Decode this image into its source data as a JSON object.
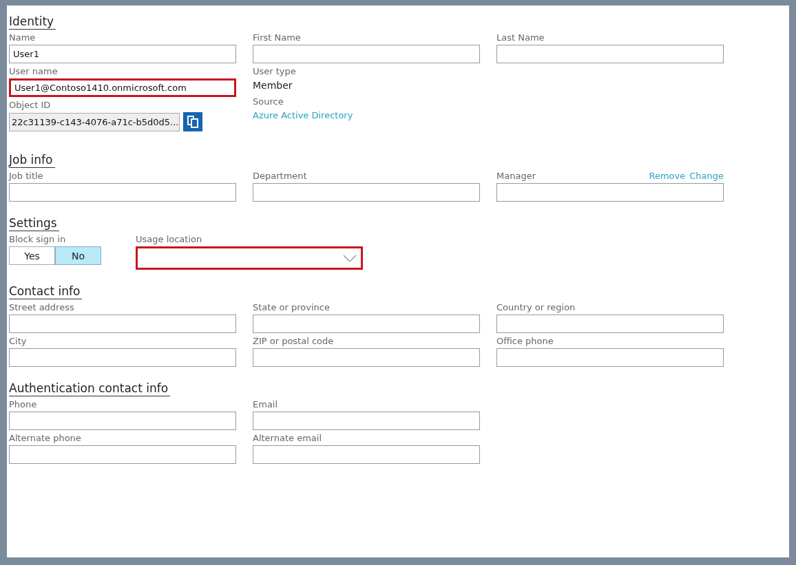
{
  "sections": [
    {
      "title": "Identity",
      "columns": [
        [
          {
            "kind": "text",
            "label": "Name",
            "value": "User1",
            "highlighted": false
          },
          {
            "kind": "text",
            "label": "User name",
            "value": "User1@Contoso1410.onmicrosoft.com",
            "highlighted": true
          },
          {
            "kind": "copy",
            "label": "Object ID",
            "value": "22c31139-c143-4076-a71c-b5d0d5..."
          }
        ],
        [
          {
            "kind": "text",
            "label": "First Name",
            "highlighted": false
          },
          {
            "kind": "static",
            "label": "User type",
            "value": "Member"
          },
          {
            "kind": "link",
            "label": "Source",
            "value": "Azure Active Directory"
          }
        ],
        [
          {
            "kind": "text",
            "label": "Last Name",
            "highlighted": false
          }
        ]
      ]
    },
    {
      "title": "Job info",
      "columns": [
        [
          {
            "kind": "text",
            "label": "Job title",
            "highlighted": false
          }
        ],
        [
          {
            "kind": "text",
            "label": "Department",
            "highlighted": false
          }
        ],
        [
          {
            "kind": "text",
            "label": "Manager",
            "highlighted": false,
            "actions": [
              "Remove",
              "Change"
            ]
          }
        ]
      ]
    },
    {
      "title": "Settings",
      "columns": [
        [
          {
            "kind": "toggle",
            "label": "Block sign in",
            "options": [
              {
                "label": "Yes",
                "selected": false
              },
              {
                "label": "No",
                "selected": true
              }
            ]
          }
        ],
        [
          {
            "kind": "dropdown",
            "label": "Usage location",
            "highlighted": true
          }
        ]
      ]
    },
    {
      "title": "Contact info",
      "columns": [
        [
          {
            "kind": "text",
            "label": "Street address",
            "highlighted": false
          },
          {
            "kind": "text",
            "label": "City",
            "highlighted": false
          }
        ],
        [
          {
            "kind": "text",
            "label": "State or province",
            "highlighted": false
          },
          {
            "kind": "text",
            "label": "ZIP or postal code",
            "highlighted": false
          }
        ],
        [
          {
            "kind": "text",
            "label": "Country or region",
            "highlighted": false
          },
          {
            "kind": "text",
            "label": "Office phone",
            "highlighted": false
          }
        ]
      ]
    },
    {
      "title": "Authentication contact info",
      "columns": [
        [
          {
            "kind": "text",
            "label": "Phone",
            "highlighted": false
          },
          {
            "kind": "text",
            "label": "Alternate phone",
            "highlighted": false
          }
        ],
        [
          {
            "kind": "text",
            "label": "Email",
            "highlighted": false
          },
          {
            "kind": "text",
            "label": "Alternate email",
            "highlighted": false
          }
        ]
      ]
    }
  ]
}
